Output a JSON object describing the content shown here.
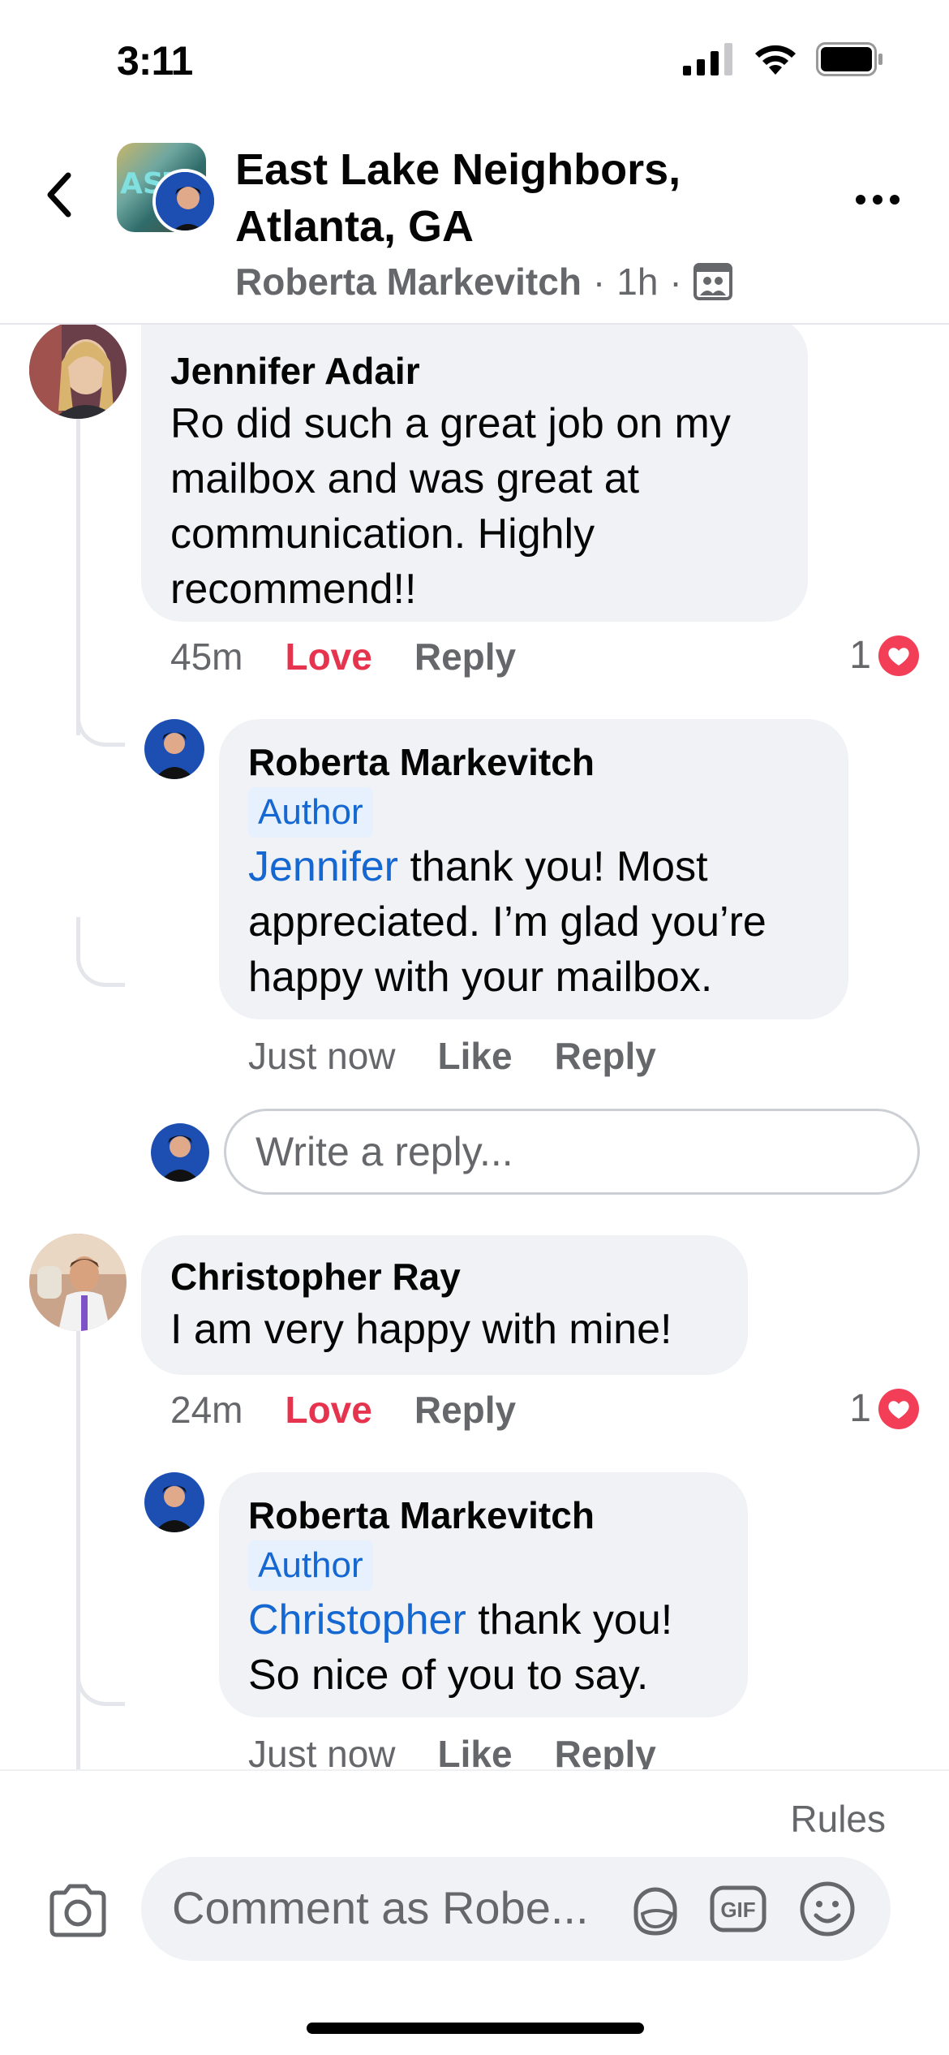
{
  "status_bar": {
    "time": "3:11"
  },
  "header": {
    "title": "East Lake Neighbors, Atlanta, GA",
    "author": "Roberta Markevitch",
    "time": "1h",
    "separator": "·"
  },
  "comments": [
    {
      "name": "Jennifer Adair",
      "text": "Ro did such a great job on my mailbox and was great at communication. Highly recommend!!",
      "time": "45m",
      "reaction_label": "Love",
      "reply_label": "Reply",
      "reaction_count": "1",
      "reply": {
        "name": "Roberta Markevitch",
        "badge": "Author",
        "mention": "Jennifer",
        "text": " thank you! Most appreciated. I’m glad you’re happy with your mailbox.",
        "time": "Just now",
        "like_label": "Like",
        "reply_label": "Reply"
      },
      "reply_input_placeholder": "Write a reply..."
    },
    {
      "name": "Christopher Ray",
      "text": "I am very happy with mine!",
      "time": "24m",
      "reaction_label": "Love",
      "reply_label": "Reply",
      "reaction_count": "1",
      "reply": {
        "name": "Roberta Markevitch",
        "badge": "Author",
        "mention": "Christopher",
        "text": " thank you! So nice of you to say.",
        "time": "Just now",
        "like_label": "Like",
        "reply_label": "Reply"
      }
    }
  ],
  "footer": {
    "rules": "Rules",
    "comment_placeholder": "Comment as Robe...",
    "gif_label": "GIF"
  },
  "colors": {
    "accent_blue": "#1567d1",
    "love_red": "#e6344f",
    "bubble_gray": "#f0f2f5",
    "secondary_text": "#65676b"
  },
  "icons": [
    "back-chevron-icon",
    "more-icon",
    "group-icon",
    "heart-reaction-icon",
    "camera-icon",
    "sticker-icon",
    "gif-icon",
    "emoji-icon"
  ]
}
